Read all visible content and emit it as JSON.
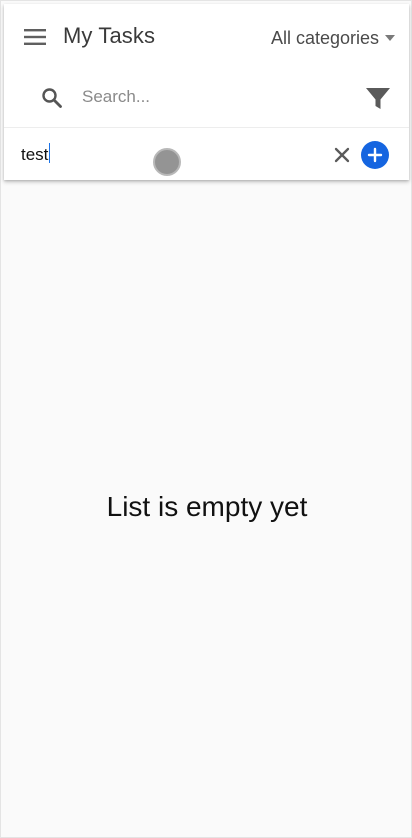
{
  "appbar": {
    "title": "My Tasks",
    "category_filter": "All categories",
    "menu_icon": "hamburger-menu-icon"
  },
  "search": {
    "placeholder": "Search...",
    "value": "",
    "icon": "search-icon",
    "filter_icon": "filter-funnel-icon"
  },
  "new_task": {
    "value": "test",
    "clear_icon": "close-icon",
    "add_icon": "add-circle-icon"
  },
  "main": {
    "empty_message": "List is empty yet"
  },
  "colors": {
    "accent": "#1565e0",
    "background": "#fafafa",
    "toolbar": "#ffffff",
    "icon_gray": "#616161"
  }
}
